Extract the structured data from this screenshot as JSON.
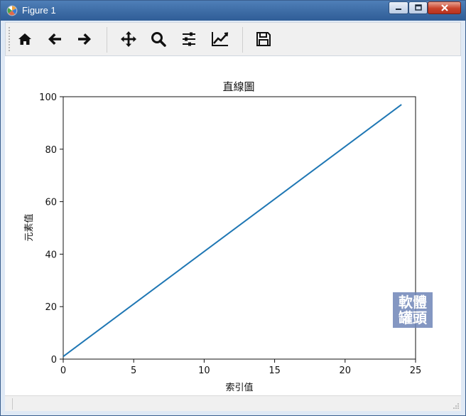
{
  "window": {
    "title": "Figure 1"
  },
  "toolbar": {
    "tools": [
      {
        "name": "home-icon"
      },
      {
        "name": "back-arrow-icon"
      },
      {
        "name": "forward-arrow-icon"
      },
      {
        "name": "pan-icon"
      },
      {
        "name": "zoom-icon"
      },
      {
        "name": "configure-subplots-icon"
      },
      {
        "name": "edit-axis-icon"
      },
      {
        "name": "save-icon"
      }
    ]
  },
  "watermark": {
    "text": "軟體罐頭"
  },
  "chart_data": {
    "type": "line",
    "title": "直線圖",
    "xlabel": "索引值",
    "ylabel": "元素值",
    "xlim": [
      0,
      25
    ],
    "ylim": [
      0,
      100
    ],
    "xticks": [
      "0",
      "5",
      "10",
      "15",
      "20",
      "25"
    ],
    "yticks": [
      "0",
      "20",
      "40",
      "60",
      "80",
      "100"
    ],
    "series": [
      {
        "color": "#1f77b4",
        "x": [
          0,
          24
        ],
        "y": [
          1,
          97
        ]
      }
    ],
    "grid": false,
    "legend": false
  }
}
